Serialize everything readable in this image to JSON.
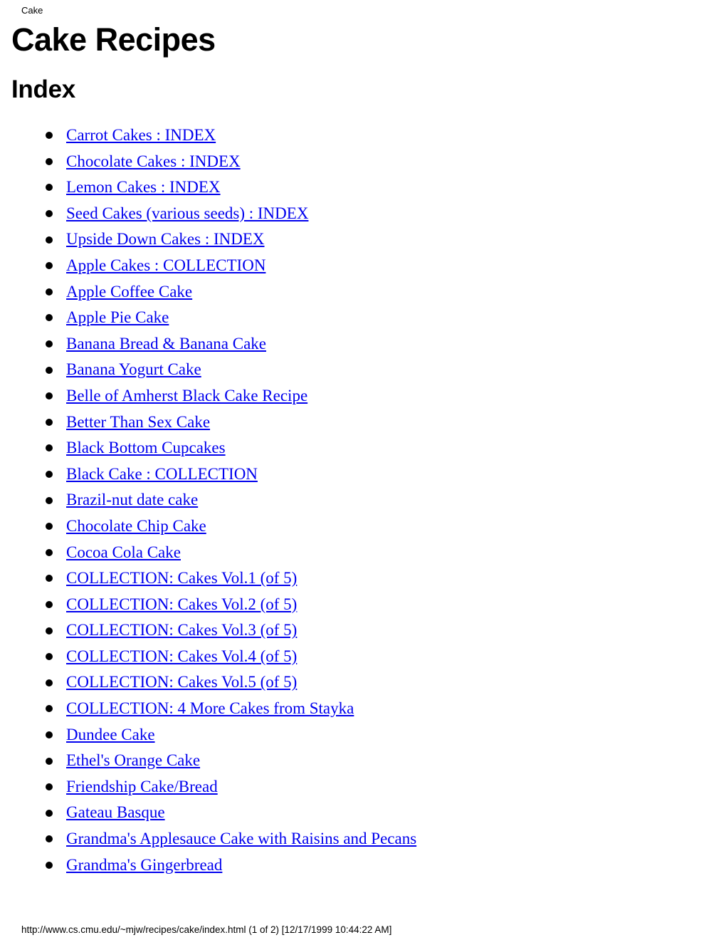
{
  "page_header": {
    "text": "Cake"
  },
  "document": {
    "title": "Cake Recipes",
    "section_heading": "Index"
  },
  "colors": {
    "link": "#0000EE",
    "text": "#000000",
    "background": "#FFFFFF"
  },
  "index": {
    "bullet_glyph": "•",
    "items": [
      {
        "label": "Carrot Cakes : INDEX"
      },
      {
        "label": "Chocolate Cakes : INDEX"
      },
      {
        "label": "Lemon Cakes : INDEX"
      },
      {
        "label": "Seed Cakes (various seeds) : INDEX"
      },
      {
        "label": "Upside Down Cakes : INDEX"
      },
      {
        "label": "Apple Cakes : COLLECTION"
      },
      {
        "label": "Apple Coffee Cake"
      },
      {
        "label": "Apple Pie Cake"
      },
      {
        "label": "Banana Bread & Banana Cake"
      },
      {
        "label": "Banana Yogurt Cake"
      },
      {
        "label": "Belle of Amherst Black Cake Recipe"
      },
      {
        "label": "Better Than Sex Cake"
      },
      {
        "label": "Black Bottom Cupcakes"
      },
      {
        "label": "Black Cake : COLLECTION"
      },
      {
        "label": "Brazil-nut date cake"
      },
      {
        "label": "Chocolate Chip Cake"
      },
      {
        "label": "Cocoa Cola Cake"
      },
      {
        "label": "COLLECTION: Cakes Vol.1 (of 5)"
      },
      {
        "label": "COLLECTION: Cakes Vol.2 (of 5)"
      },
      {
        "label": "COLLECTION: Cakes Vol.3 (of 5)"
      },
      {
        "label": "COLLECTION: Cakes Vol.4 (of 5)"
      },
      {
        "label": "COLLECTION: Cakes Vol.5 (of 5)"
      },
      {
        "label": "COLLECTION: 4 More Cakes from Stayka"
      },
      {
        "label": "Dundee Cake"
      },
      {
        "label": "Ethel's Orange Cake"
      },
      {
        "label": "Friendship Cake/Bread"
      },
      {
        "label": "Gateau Basque"
      },
      {
        "label": "Grandma's Applesauce Cake with Raisins and Pecans"
      },
      {
        "label": "Grandma's Gingerbread"
      }
    ]
  },
  "page_footer": {
    "text": "http://www.cs.cmu.edu/~mjw/recipes/cake/index.html (1 of 2) [12/17/1999 10:44:22 AM]",
    "url": "http://www.cs.cmu.edu/~mjw/recipes/cake/index.html",
    "page_indicator": "(1 of 2)",
    "timestamp": "[12/17/1999 10:44:22 AM]"
  }
}
